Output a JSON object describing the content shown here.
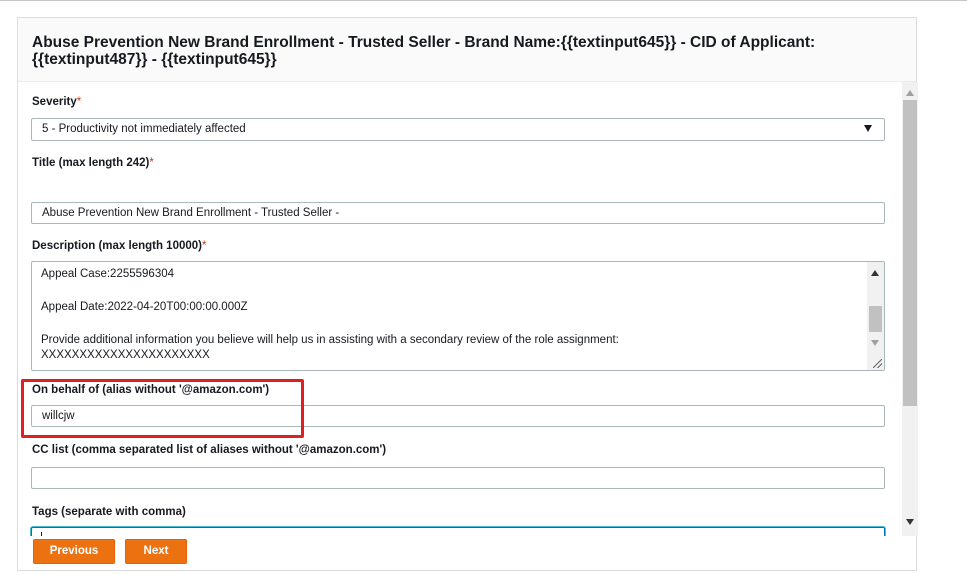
{
  "header": {
    "title": "Abuse Prevention New Brand Enrollment - Trusted Seller - Brand Name:{{textinput645}} - CID of Applicant:{{textinput487}} - {{textinput645}}"
  },
  "form": {
    "required_marker": "*",
    "severity": {
      "label": "Severity",
      "value": "5 - Productivity not immediately affected"
    },
    "title_field": {
      "label": "Title (max length 242)",
      "value": "Abuse Prevention New Brand Enrollment - Trusted Seller -"
    },
    "description": {
      "label": "Description (max length 10000)",
      "lines": [
        "Appeal Case:2255596304",
        "Appeal Date:2022-04-20T00:00:00.000Z",
        "Provide additional information you believe will help us in assisting with a secondary review of the role assignment:",
        "XXXXXXXXXXXXXXXXXXXXXX"
      ]
    },
    "on_behalf_of": {
      "label": "On behalf of (alias without '@amazon.com')",
      "value": "willcjw"
    },
    "cc_list": {
      "label": "CC list (comma separated list of aliases without '@amazon.com')",
      "value": ""
    },
    "tags": {
      "label": "Tags (separate with comma)",
      "value": ""
    }
  },
  "footer": {
    "previous_label": "Previous",
    "next_label": "Next"
  },
  "colors": {
    "accent": "#ec7211",
    "required": "#d13212",
    "focus": "#0073bb",
    "highlight": "#e02020"
  }
}
